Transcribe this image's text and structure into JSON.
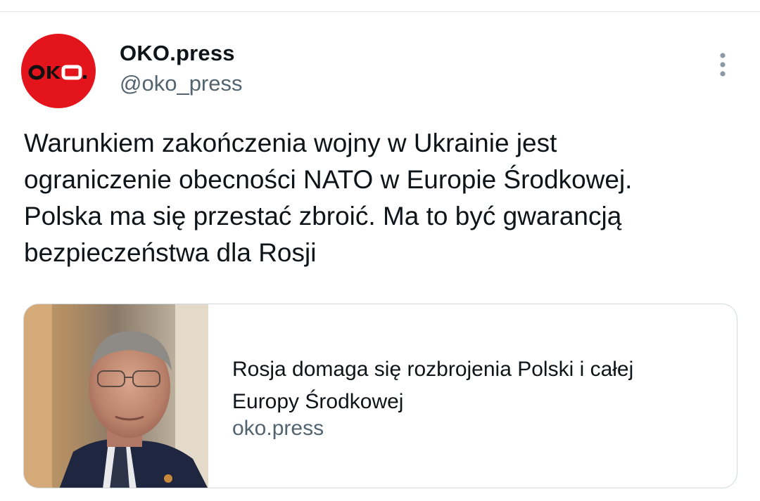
{
  "tweet": {
    "author": {
      "display_name": "OKO.press",
      "handle": "@oko_press",
      "avatar_logo_text": "OKO.",
      "avatar_color": "#e3141b",
      "avatar_icon": "oko-press-logo"
    },
    "more_icon": "vertical-ellipsis-icon",
    "text": "Warunkiem zakończenia wojny w Ukrainie jest\nograniczenie obecności NATO w Europie Środkowej.\nPolska ma się przestać zbroić. Ma to być gwarancją\nbezpieczeństwa dla Rosji",
    "link_card": {
      "image_description_icon": "article-thumbnail",
      "title": "Rosja domaga się rozbrojenia Polski i całej\nEuropy Środkowej",
      "domain": "oko.press"
    }
  },
  "colors": {
    "text_primary": "#0f1419",
    "text_secondary": "#536471",
    "border": "#cfd9de"
  }
}
